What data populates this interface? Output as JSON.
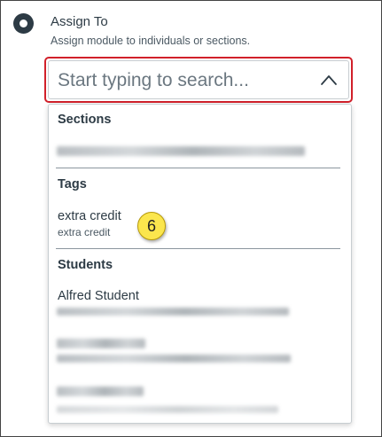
{
  "assign": {
    "title": "Assign To",
    "description": "Assign module to individuals or sections."
  },
  "search": {
    "placeholder": "Start typing to search...",
    "chevron_icon": "chevron-up-icon",
    "border_color": "#d1202a"
  },
  "groups": {
    "sections": {
      "header": "Sections"
    },
    "tags": {
      "header": "Tags",
      "items": [
        {
          "label": "extra credit",
          "sublabel": "extra credit"
        }
      ]
    },
    "students": {
      "header": "Students",
      "items": [
        {
          "label": "Alfred Student"
        }
      ]
    }
  },
  "callout": {
    "number": "6",
    "color": "#fbe64d"
  }
}
